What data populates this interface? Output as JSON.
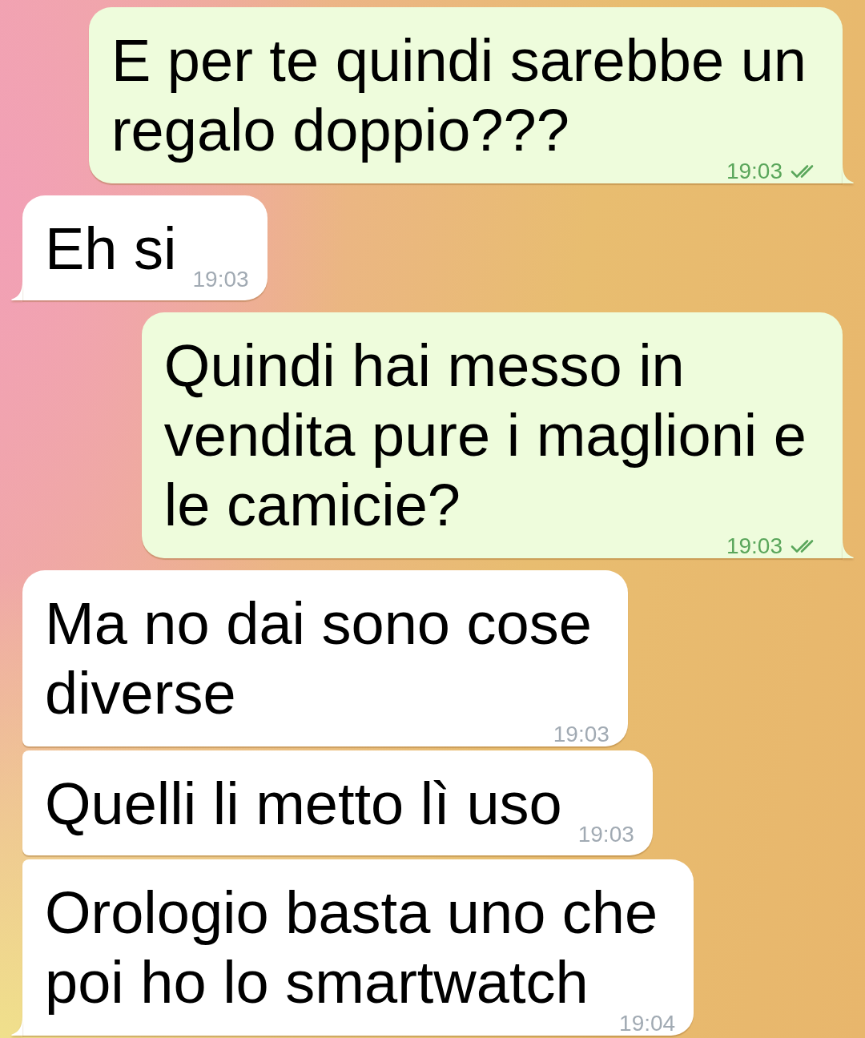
{
  "messages": [
    {
      "kind": "outgoing",
      "lines": [
        "E per te quindi sarebbe un",
        "regalo doppio???"
      ],
      "time": "19:03",
      "read": true
    },
    {
      "kind": "incoming",
      "lines": [
        "Eh si"
      ],
      "time": "19:03"
    },
    {
      "kind": "outgoing",
      "lines": [
        "Quindi hai messo in",
        "vendita pure i maglioni e",
        "le camicie?"
      ],
      "time": "19:03",
      "read": true
    },
    {
      "kind": "incoming",
      "lines": [
        "Ma no dai sono cose",
        "diverse"
      ],
      "time": "19:03"
    },
    {
      "kind": "incoming",
      "lines": [
        "Quelli li metto lì uso"
      ],
      "time": "19:03"
    },
    {
      "kind": "incoming",
      "lines": [
        "Orologio basta uno che",
        "poi ho lo smartwatch"
      ],
      "time": "19:04"
    }
  ]
}
